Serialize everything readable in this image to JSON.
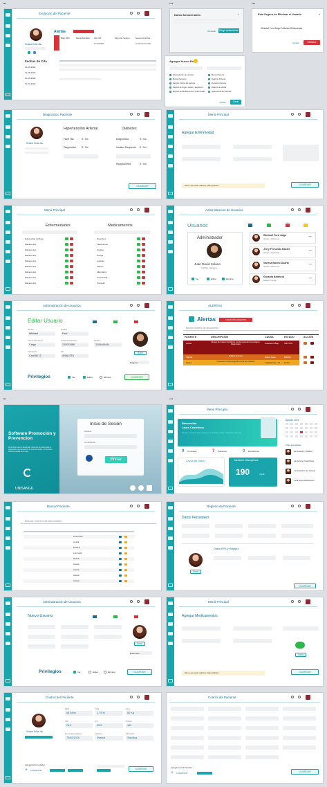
{
  "board_dots": "•••",
  "f1": {
    "title": "Evolución del Paciente",
    "patient_name": "Solana Sofía Jáu",
    "alerts_title": "Alertas",
    "alerts_badge": "",
    "alert_cols": [
      "Bajo 40%",
      "Medio Moderar",
      "Alto 4%",
      "Muy alto Severo",
      "Severo Autoriza ...",
      "Consistible",
      "Unanimo Fechas"
    ],
    "dates_title": "Fechas de Cita",
    "dates": [
      "10-15-2020",
      "10-15-2020",
      "10-15-2020",
      "10-10-2020"
    ]
  },
  "f2": {
    "title": "Datos Almacenados",
    "body": "",
    "btn_cancel": "Cancelar",
    "btn_ok": "Elegir seleccionar"
  },
  "f2b": {
    "title": "Agregar Nuevo Rol",
    "options": [
      "Administración de Usuarios",
      "Buscar Pacientes",
      "Registro Control del paciente",
      "Registro de Signos vitales y Seguimien...",
      "Registro de Medicamentos y Enfermedad",
      "Buscar Paciente",
      "Registrar Paciente",
      "Evolución Paciente",
      "Registro de Alertas",
      "Seguimiento del Paciente"
    ],
    "btn_cancel": "Cancel",
    "btn_ok": "Crear"
  },
  "f3": {
    "title": "Esta Seguro de Eliminar el Usuario",
    "user": "Winbasf   Ford   Jaigo   Falbelau   Rellenancia",
    "btn_cancel": "Cancel",
    "btn_delete": "Eliminar"
  },
  "f4": {
    "title": "Diagnostico Paciente",
    "name": "Solana Sofía Jáu",
    "h1": "Hipertensión Arterial",
    "h2": "Diabetes",
    "q1": "Hace Hta",
    "q2": "Diagnóstico",
    "opt": "S / No",
    "q3": "Diagnóstico",
    "q4": "Insulino Requiente",
    "q5": "Hipoglucemia",
    "save": "GUARDAR"
  },
  "f5": {
    "title": "Menú Principal",
    "heading": "Agregar Enfermedad",
    "notice": "Paso a que puede realizar y están aprobado",
    "save": "GUARDAR"
  },
  "f6": {
    "title": "Menú Principal",
    "col1": "Enfermedades",
    "col2": "Medicamentos",
    "rows1": [
      "Enfermedad cardiaca",
      "Diabetes tipo",
      "Diabetes tipo",
      "Diabetes tipo",
      "Diabetes tipo",
      "Diabetes tipo",
      "Diabetes tipo",
      "Diabetes tipo",
      "Diabetes tipo"
    ],
    "rows2": [
      "Ibuprofeno",
      "Paracetamol",
      "Insulina",
      "Omega",
      "Losartan",
      "Ataprox",
      "Albendazol",
      "Tropicamida",
      "Tramadol"
    ]
  },
  "f7": {
    "title": "Administración de Usuarios",
    "heading": "Usuarios",
    "card_title": "Administrador",
    "card_name": "Juan David Solano",
    "card_sub": "471234a - Abstencia",
    "users": [
      {
        "name": "Winbasf Ford Jaigo",
        "sub": "Analista - Abstinencia"
      },
      {
        "name": "Jerry Fernando Baxter",
        "sub": "Analista - Abstinencia"
      },
      {
        "name": "Vanesa Bueno Duarte",
        "sub": "Analista - Abstinencia"
      },
      {
        "name": "Gorarda Balancia",
        "sub": "Analista - Integral"
      }
    ],
    "opts": [
      "Ver",
      "Editar",
      "Eliminar"
    ]
  },
  "f8": {
    "title": "Administración de Usuarios",
    "heading": "Editar Usuario",
    "fields": [
      {
        "label": "Nombre",
        "value": "Winbasf"
      },
      {
        "label": "Apellido",
        "value": "Ford"
      },
      {
        "label": "Tipo de Documento",
        "value": "Cargo"
      },
      {
        "label": "Fecha de Nacimiento",
        "value": "13/02/1988"
      },
      {
        "label": "Teléfono",
        "value": "3104444444"
      },
      {
        "label": "Contraseña",
        "value": "Carc5t8 12"
      },
      {
        "label": "Rol",
        "value": "ANALISTA"
      }
    ],
    "privileges": "Privilegios",
    "opts": [
      "Ver",
      "Editar",
      "Eliminar"
    ],
    "save": "GUARDAR",
    "select": "Ninguno"
  },
  "f9": {
    "title": "ALERTAS",
    "heading": "Alertas",
    "badge": "ATENCIÓN URGENTE",
    "search": "Buscar numero de documento",
    "headers": [
      "PATIENTE",
      "DESCRIPCIÓN",
      "CAUSA",
      "ESTADO",
      "ACCIÓN"
    ],
    "rows": [
      {
        "p": "Lucas",
        "d": "Riesgo de Caseos Accidente cerebrovascular hemorrágico. Diagnóstico",
        "c": "Colesterol Bajo",
        "e": "CRITICO"
      },
      {
        "p": "Martha",
        "d": "Exiliado del peso",
        "c": "Sobre Peso",
        "e": "MEDIO"
      },
      {
        "p": "Pedro",
        "d": "Pasapase a Placentagrafia Cuida de Diabetes",
        "c": "Triglicéridos >10",
        "e": "ALTO"
      }
    ]
  },
  "f10": {
    "brand_title": "Software Promoción y Prevencion",
    "brand_sub": "Promoción para el desarrollo, acciones de salud para la mejora de una prevención de la enfermedad y el proceso hacia la calidad de la vida.",
    "logo": "UNISANGIL",
    "login_title": "Inicio de Sesión",
    "user_label": "Usuario",
    "pass_label": "Contraseña",
    "enter": "Entrar"
  },
  "f11": {
    "title": "Menú Principal",
    "banner_1": "Bienvenida",
    "banner_2": "Laura Castellana",
    "banner_sub": "El medico recomienda llevar una dieta más saludable y realizar actividad fisica frecuente.",
    "stats": [
      {
        "n": "9",
        "l": "Consultas"
      },
      {
        "n": "7",
        "l": "Pacientes"
      },
      {
        "n": "0",
        "l": "Evoluciones"
      }
    ],
    "curve": "Curva de Salud",
    "glucose": "Medición Glucogénica",
    "glucose_val": "190",
    "glucose_unit": "mg/dl",
    "cal_title": "Agosto 2020",
    "list_title": "Citas agendadas",
    "people": [
      "Luis Jaramillo - Dia Mayo",
      "Luis Sanchez Cuad Alfonso",
      "Luis Jaramillo 1 tipo Canaval",
      "Lucila Duarte Abad Jiménez"
    ]
  },
  "f12": {
    "title": "Buscar Paciente",
    "search": "Buscar numero de documento",
    "rows": [
      "Kenia Porta",
      "Amada",
      "Estesino",
      "Luis Farah",
      "Ricardo",
      "Arevalo",
      "Arévalo",
      "Arévalo",
      "Arévalo"
    ]
  },
  "f13": {
    "title": "Registro de Paciente",
    "heading": "Datos Personales",
    "heading2": "Datos EPS y Registro",
    "btn": "Subir",
    "save": "GUARDAR"
  },
  "f14": {
    "title": "Administración de Usuarios",
    "heading": "Nuevo Usuario",
    "privileges": "Privilegios",
    "opts": [
      "Ver",
      "Editar",
      "Eliminar"
    ],
    "save": "GUARDAR",
    "select": "Enfermero",
    "btn": "Subir"
  },
  "f15": {
    "title": "Menú Principal",
    "heading": "Agregar Medicamentos",
    "notice": "Paso a que puede realizar y están aprobado",
    "btn": "Subir",
    "save": "GUARDAR"
  },
  "f16": {
    "title": "Control del Paciente",
    "name": "Solana Sofía Jáu",
    "labels": [
      "Edad",
      "Talla",
      "Peso",
      "IMC",
      "P.A",
      "Presión",
      "Frecuencia Cardiaca",
      "Respirac",
      "Saturacion"
    ],
    "values": [
      "55 Años",
      "1,75 M",
      "80 Kg",
      "26,3",
      "90/3",
      "162",
      "75/92/2020",
      "Normal",
      "Sistolica"
    ],
    "footer_label": "Agregar Enfermedades",
    "footer_val": "LOSARTAN",
    "save": "GUARDAR"
  },
  "f17": {
    "title": "Control del Paciente",
    "footer_label": "Agregar control Paciente",
    "footer_val": "LOSARTAN",
    "save": "GUARDAR"
  }
}
